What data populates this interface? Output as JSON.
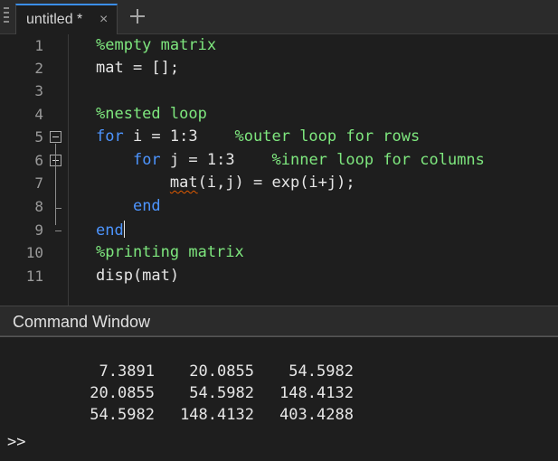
{
  "tab": {
    "title": "untitled *",
    "close_glyph": "×",
    "add_icon": "plus-icon"
  },
  "editor": {
    "lines": [
      {
        "num": "1",
        "comment": "%empty matrix"
      },
      {
        "num": "2",
        "code": "mat = [];"
      },
      {
        "num": "3"
      },
      {
        "num": "4",
        "comment": "%nested loop"
      },
      {
        "num": "5",
        "kw": "for",
        "code": " i = 1:3    ",
        "comment": "%outer loop for rows"
      },
      {
        "num": "6",
        "indent": "    ",
        "kw": "for",
        "code": " j = 1:3    ",
        "comment": "%inner loop for columns"
      },
      {
        "num": "7",
        "indent": "        ",
        "squiggle": "mat",
        "code": "(i,j) = exp(i+j);"
      },
      {
        "num": "8",
        "indent": "    ",
        "kw": "end"
      },
      {
        "num": "9",
        "kw": "end"
      },
      {
        "num": "10",
        "comment": "%printing matrix"
      },
      {
        "num": "11",
        "code": "disp(mat)"
      }
    ]
  },
  "command_window": {
    "title": "Command Window",
    "output": [
      [
        "7.3891",
        "20.0855",
        "54.5982"
      ],
      [
        "20.0855",
        "54.5982",
        "148.4132"
      ],
      [
        "54.5982",
        "148.4132",
        "403.4288"
      ]
    ],
    "prompt": ">>"
  },
  "colors": {
    "comment": "#7ee77e",
    "keyword": "#4d95ff",
    "background": "#1e1e1e",
    "accent": "#3b8eea"
  }
}
